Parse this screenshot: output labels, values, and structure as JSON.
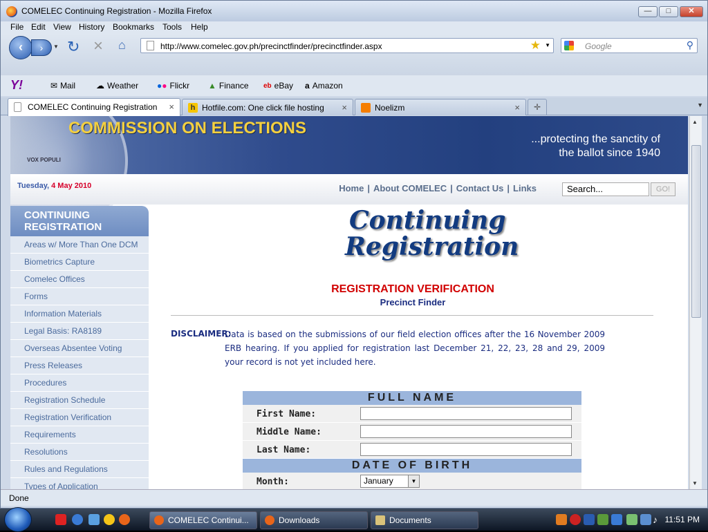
{
  "window": {
    "title": "COMELEC Continuing Registration - Mozilla Firefox"
  },
  "menu": [
    "File",
    "Edit",
    "View",
    "History",
    "Bookmarks",
    "Tools",
    "Help"
  ],
  "nav": {
    "url": "http://www.comelec.gov.ph/precinctfinder/precinctfinder.aspx",
    "search_placeholder": "Google"
  },
  "toolbar": {
    "mail": "Mail",
    "weather": "Weather",
    "flickr": "Flickr",
    "finance": "Finance",
    "ebay": "eBay",
    "amazon": "Amazon"
  },
  "tabs": [
    {
      "label": "COMELEC Continuing Registration"
    },
    {
      "label": "Hotfile.com: One click file hosting"
    },
    {
      "label": "Noelizm"
    }
  ],
  "site": {
    "banner_title": "COMMISSION ON ELECTIONS",
    "tagline1": "...protecting the sanctity of",
    "tagline2": "the ballot since 1940",
    "seal_text": "VOX POPULI",
    "date_day": "Tuesday,",
    "date_rest": "4 May 2010",
    "nav": [
      "Home",
      "About COMELEC",
      "Contact Us",
      "Links"
    ],
    "search_placeholder": "Search...",
    "go": "GO!"
  },
  "sidebar": {
    "header": "CONTINUING REGISTRATION",
    "items": [
      "Areas w/ More Than One DCM",
      "Biometrics Capture",
      "Comelec Offices",
      "Forms",
      "Information Materials",
      "Legal Basis: RA8189",
      "Overseas Absentee Voting",
      "Press Releases",
      "Procedures",
      "Registration Schedule",
      "Registration Verification",
      "Requirements",
      "Resolutions",
      "Rules and Regulations",
      "Types of Application"
    ]
  },
  "main": {
    "logo_line1": "Continuing",
    "logo_line2": "Registration",
    "title": "REGISTRATION VERIFICATION",
    "subtitle": "Precinct Finder",
    "disclaimer_label": "DISCLAIMER:",
    "disclaimer_text": "Data is based on the submissions of our field election offices after the 16 November 2009 ERB hearing. If you applied for registration last December 21, 22, 23, 28 and 29, 2009 your record is not yet included here."
  },
  "form": {
    "fullname_header": "FULL NAME",
    "first": "First Name:",
    "middle": "Middle Name:",
    "last": "Last Name:",
    "dob_header": "DATE OF BIRTH",
    "month": "Month:",
    "month_value": "January"
  },
  "status": "Done",
  "taskbar": {
    "tasks": [
      "COMELEC Continui...",
      "Downloads",
      "Documents"
    ],
    "clock": "11:51 PM"
  }
}
